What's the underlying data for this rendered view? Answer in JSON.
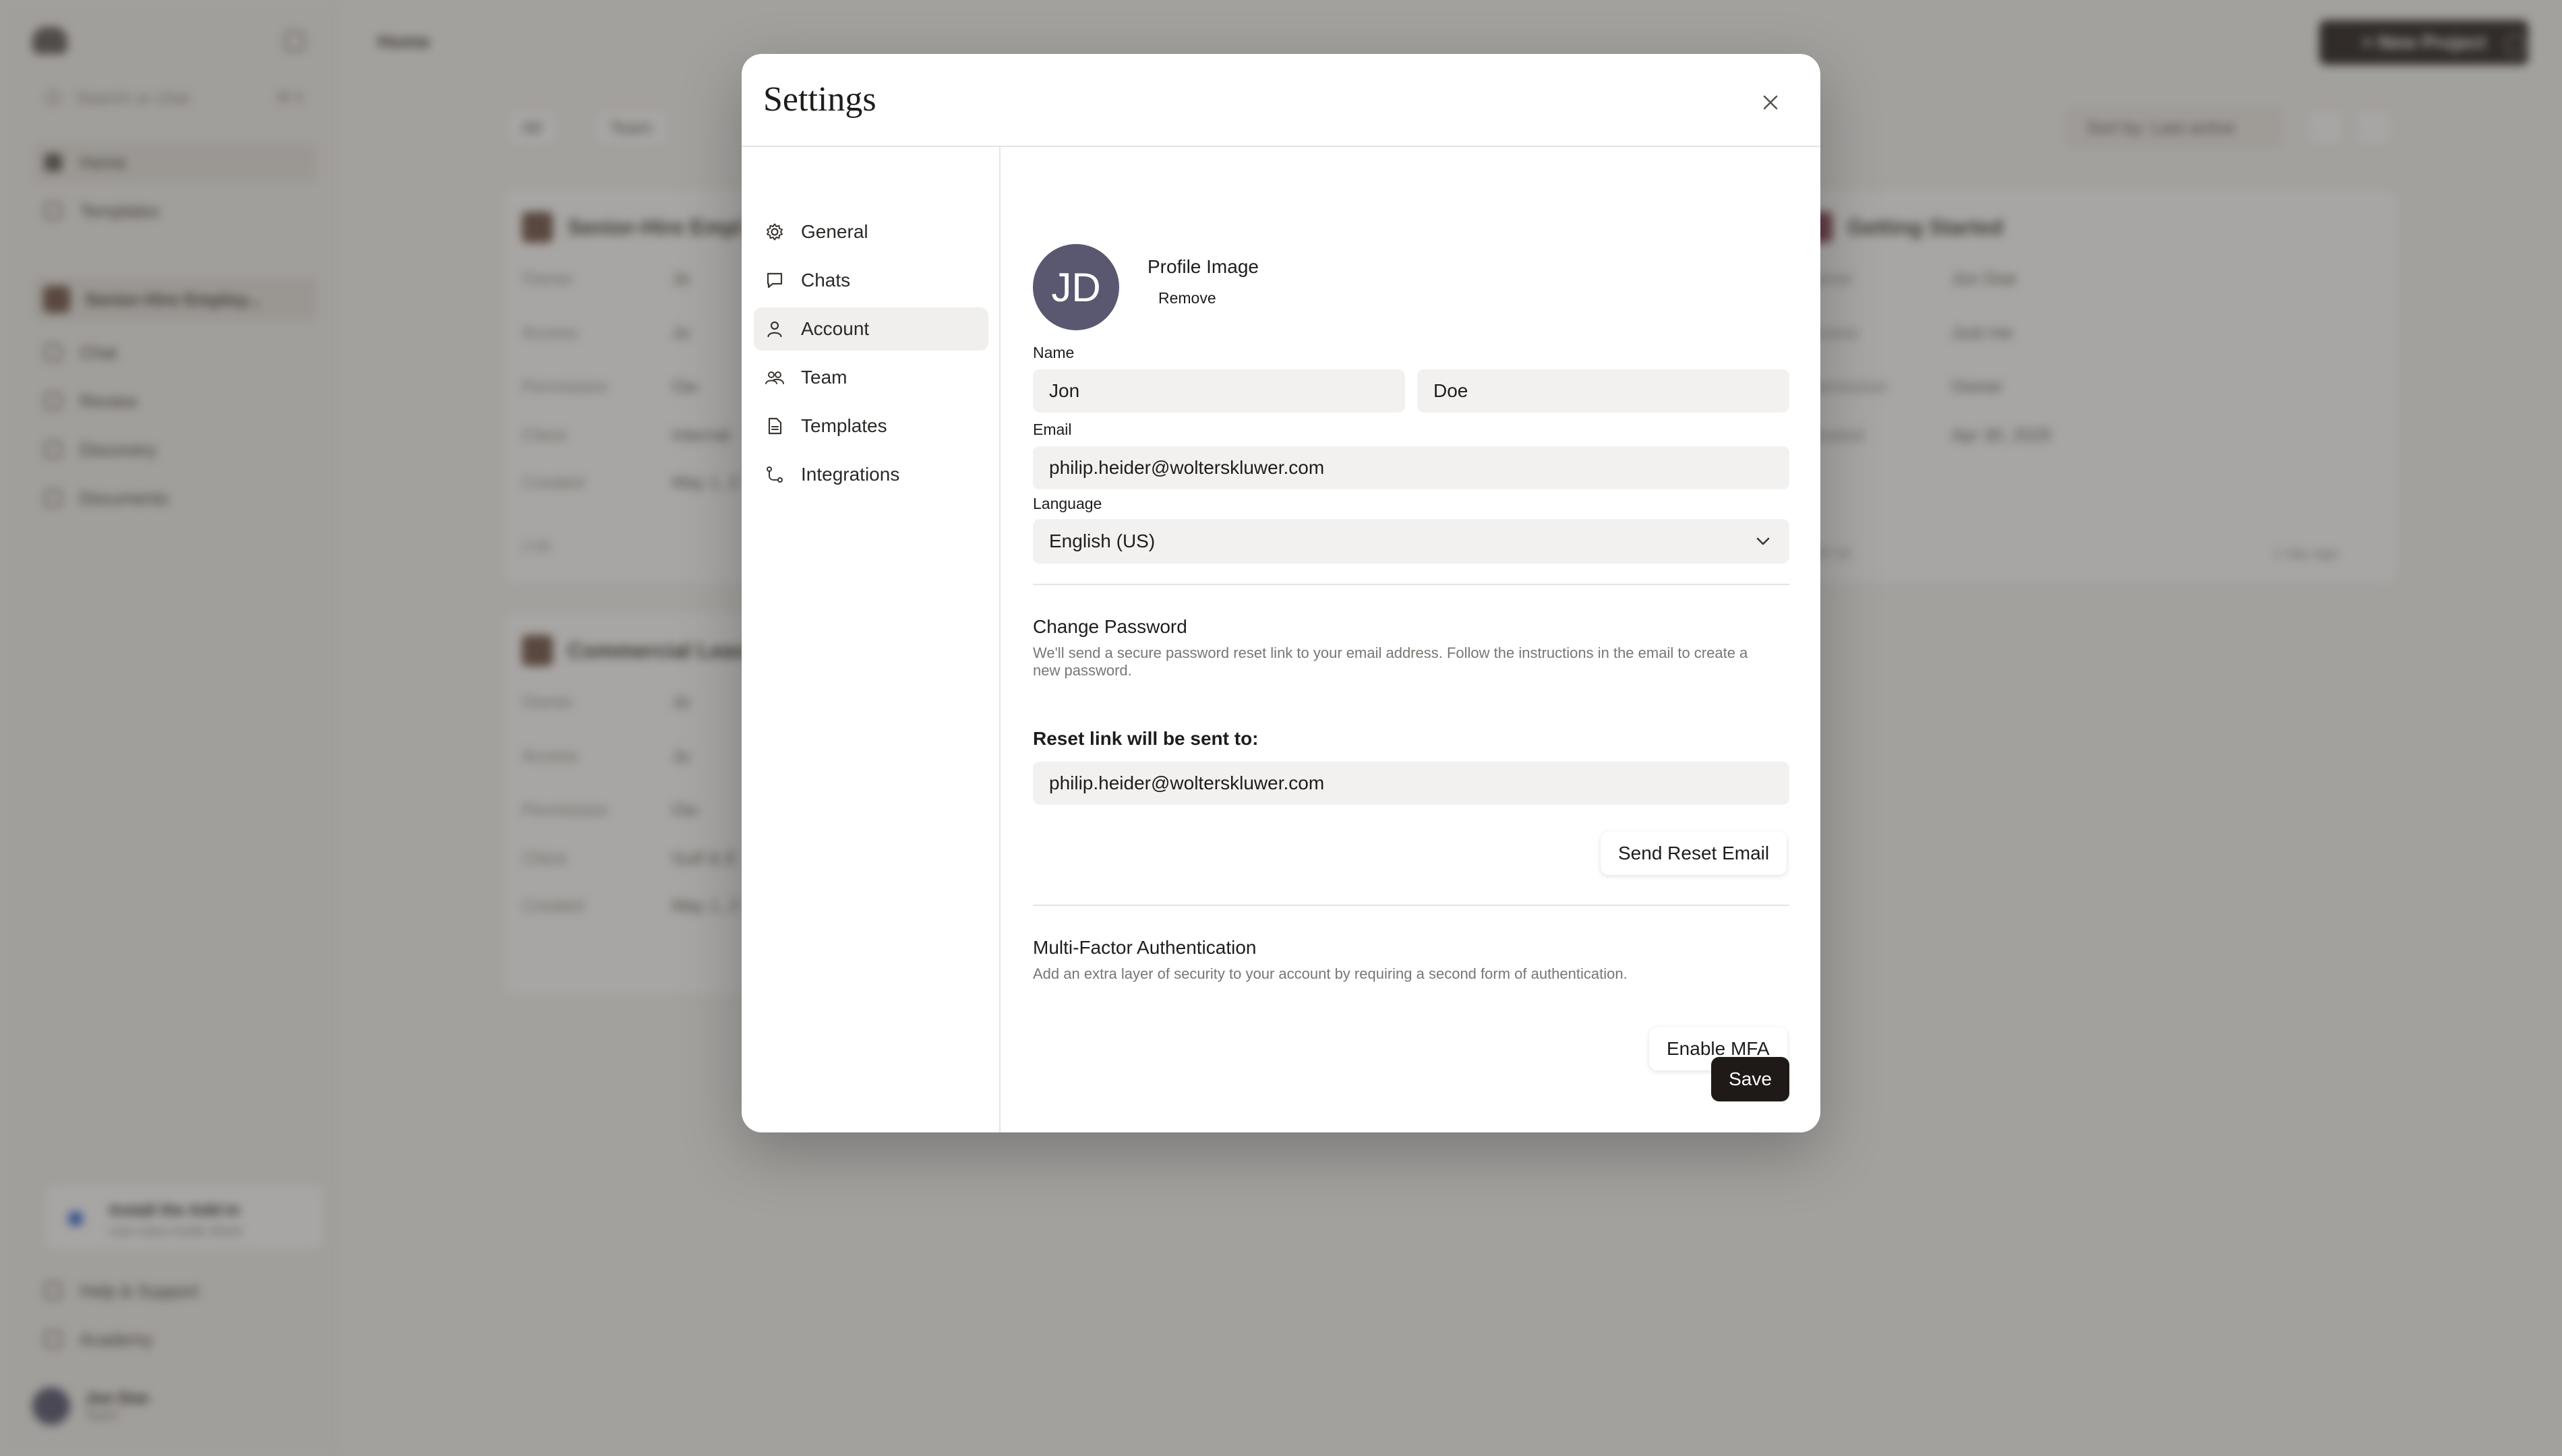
{
  "background": {
    "sidebar": {
      "search_placeholder": "Search or chat",
      "search_shortcut": "⌘ K",
      "items": [
        {
          "label": "Home"
        },
        {
          "label": "Templates"
        }
      ],
      "project": {
        "label": "Senior-Hire Employ..."
      },
      "project_items": [
        {
          "label": "Chat"
        },
        {
          "label": "Review"
        },
        {
          "label": "Discovery"
        },
        {
          "label": "Documents"
        }
      ],
      "addin": {
        "title": "Install the Add-in",
        "subtitle": "Use Libra inside Word"
      },
      "footer_links": [
        {
          "label": "Help & Support"
        },
        {
          "label": "Academy"
        }
      ],
      "user": {
        "name": "Jon Doe",
        "role": "Team"
      }
    },
    "topbar": {
      "title": "Home",
      "new_project": "+ New Project"
    },
    "filters": {
      "all": "All",
      "team": "Team",
      "sort": "Sort by: Last active"
    },
    "cards": [
      {
        "title": "Senior-Hire Empl",
        "rows": [
          {
            "k": "Owner",
            "v": "Jo"
          },
          {
            "k": "Access",
            "v": "Ju"
          },
          {
            "k": "Permission",
            "v": "Ow"
          },
          {
            "k": "Client",
            "v": "Internal"
          },
          {
            "k": "Created",
            "v": "May 1, 2"
          }
        ],
        "footer": "2   93"
      },
      {
        "title": "Getting Started",
        "rows": [
          {
            "k": "Owner",
            "v": "Jon Doe"
          },
          {
            "k": "Access",
            "v": "Just me"
          },
          {
            "k": "Permission",
            "v": "Owner"
          },
          {
            "k": "Created",
            "v": "Apr 30, 2025"
          }
        ],
        "footer": "0   24   10",
        "time": "1 day ago"
      },
      {
        "title": "Commercial Leas",
        "rows": [
          {
            "k": "Owner",
            "v": "Jo"
          },
          {
            "k": "Access",
            "v": "Ju"
          },
          {
            "k": "Permission",
            "v": "Ow"
          },
          {
            "k": "Client",
            "v": "Gulf & E"
          },
          {
            "k": "Created",
            "v": "May 1, 2"
          }
        ]
      }
    ]
  },
  "modal": {
    "title": "Settings",
    "nav": [
      {
        "label": "General",
        "icon": "gear-icon"
      },
      {
        "label": "Chats",
        "icon": "chat-icon"
      },
      {
        "label": "Account",
        "icon": "user-icon",
        "active": true
      },
      {
        "label": "Team",
        "icon": "team-icon"
      },
      {
        "label": "Templates",
        "icon": "document-icon"
      },
      {
        "label": "Integrations",
        "icon": "integrations-icon"
      }
    ],
    "account": {
      "avatar_initials": "JD",
      "profile_image_label": "Profile Image",
      "remove_label": "Remove",
      "name_label": "Name",
      "first_name": "Jon",
      "last_name": "Doe",
      "email_label": "Email",
      "email": "philip.heider@wolterskluwer.com",
      "language_label": "Language",
      "language": "English (US)",
      "change_password_title": "Change Password",
      "change_password_desc": "We'll send a secure password reset link to your email address. Follow the instructions in the email to create a new password.",
      "reset_link_label": "Reset link will be sent to:",
      "reset_email": "philip.heider@wolterskluwer.com",
      "send_reset_label": "Send Reset Email",
      "mfa_title": "Multi-Factor Authentication",
      "mfa_desc": "Add an extra layer of security to your account by requiring a second form of authentication.",
      "enable_mfa_label": "Enable MFA",
      "save_label": "Save"
    }
  },
  "colors": {
    "primary_button": "#1f1a17",
    "avatar": "#595870",
    "overlay": "#46423e"
  }
}
